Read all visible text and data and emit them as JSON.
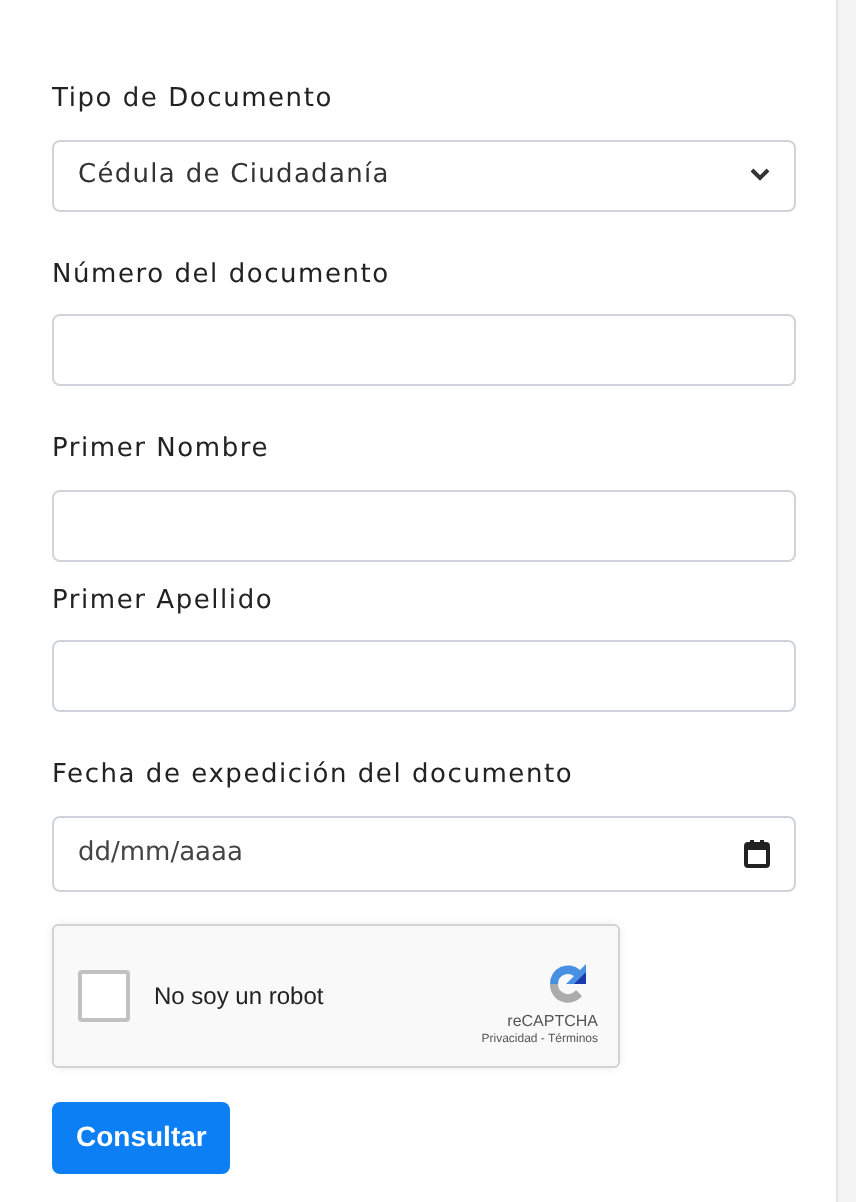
{
  "fields": [
    {
      "kind": "select",
      "label": "Tipo de Documento",
      "value": "Cédula de Ciudadanía"
    },
    {
      "kind": "text",
      "label": "Número del documento"
    },
    {
      "kind": "text",
      "label": "Primer Nombre"
    },
    {
      "kind": "text",
      "label": "Primer Apellido"
    },
    {
      "kind": "date",
      "label": "Fecha de expedición del documento",
      "placeholder": "dd/mm/aaaa"
    }
  ],
  "captcha": {
    "label": "No soy un robot",
    "checked": false,
    "brand": "reCAPTCHA",
    "links": "Privacidad - Términos"
  },
  "submit": "Consultar"
}
